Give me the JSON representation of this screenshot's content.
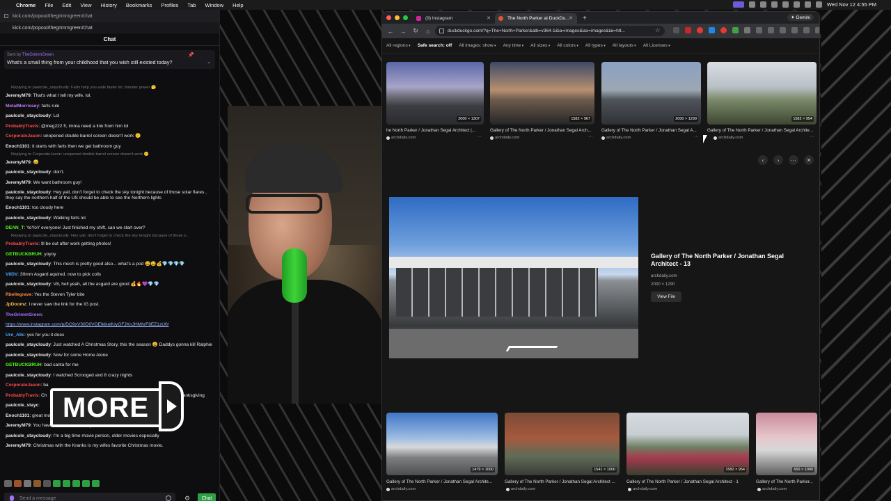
{
  "menubar": {
    "app": "Chrome",
    "items": [
      "File",
      "Edit",
      "View",
      "History",
      "Bookmarks",
      "Profiles",
      "Tab",
      "Window",
      "Help"
    ],
    "clock": "Wed Nov 12  4:55 PM"
  },
  "chat_window": {
    "url": "kick.com/popout/thegrimmgreen/chat",
    "url2": "kick.com/popout/thegrimmgreen/chat",
    "header": "Chat",
    "pinned": {
      "sent_by_prefix": "Sent by",
      "sent_by_user": "TheGrimmGreen",
      "question": "What's a small thing from your childhood that you wish still existed today?"
    },
    "messages": [
      {
        "type": "reply",
        "text": "Replying to paulcole_staycloudy: Farts help you walk faster lol, booster power 🤔"
      },
      {
        "user": "JeremyM79",
        "color": "#e8e8e8",
        "text": "That's what I tell my wife. lol."
      },
      {
        "user": "MetalMorrissey",
        "color": "#c27cff",
        "text": "farts rule"
      },
      {
        "user": "paulcole_staycloudy",
        "color": "#e8e8e8",
        "text": "Lol"
      },
      {
        "user": "ProbablyTravis",
        "color": "#ff4b4b",
        "text": "@meg222 fr, imma need a link from him lol"
      },
      {
        "user": "CorporateJason",
        "color": "#ff4b4b",
        "text": "unopened double barrel screen doesn't work 😕"
      },
      {
        "user": "Enoch1101",
        "color": "#e8e8e8",
        "text": "it starts with farts then we get bathroom guy"
      },
      {
        "type": "reply",
        "text": "Replying to CorporateJason: unopened double barrel screen doesn't work 😕"
      },
      {
        "user": "JeremyM79",
        "color": "#e8e8e8",
        "text": "😄"
      },
      {
        "user": "paulcole_staycloudy",
        "color": "#e8e8e8",
        "text": "don't."
      },
      {
        "user": "JeremyM79",
        "color": "#e8e8e8",
        "text": "We want bathroom guy!"
      },
      {
        "user": "paulcole_staycloudy",
        "color": "#e8e8e8",
        "text": "Hey yall, don't forget to check the sky tonight because of those solar flares , they say the northern half of the US should be able to see the Northern lights",
        "wrap": true
      },
      {
        "user": "Enoch1101",
        "color": "#e8e8e8",
        "text": "too cloudy here"
      },
      {
        "user": "paulcole_staycloudy",
        "color": "#e8e8e8",
        "text": "Walking farts lol"
      },
      {
        "user": "DEAN_T",
        "color": "#53fc18",
        "text": "YoYoY everyone! Just finished my shift, can we start over?"
      },
      {
        "type": "reply",
        "text": "Replying to paulcole_staycloudy: Hey yall, don't forget to check the sky tonight because of those s..."
      },
      {
        "user": "ProbablyTravis",
        "color": "#ff4b4b",
        "text": "Ill be out after work getting photos!"
      },
      {
        "user": "GETBUCKBRUH",
        "color": "#53fc18",
        "text": "yoyoy"
      },
      {
        "user": "paulcole_staycloudy",
        "color": "#e8e8e8",
        "text": "This mech is pretty good also... what's a pod 😄😄💰💎💎💎💎"
      },
      {
        "user": "V8DV",
        "color": "#4aa8ff",
        "text": "30mm Asgard aquired. now to pick coils"
      },
      {
        "user": "paulcole_staycloudy",
        "color": "#e8e8e8",
        "text": "V8, hell yeah, all the asgard are good 💰🔥💜💎💎"
      },
      {
        "user": "Rbellegrave",
        "color": "#ff8a3d",
        "text": "Yes the Steven Tyler bite"
      },
      {
        "user": "JpDoomz",
        "color": "#ffb84a",
        "text": "I never saw the link for the IG post."
      },
      {
        "user": "TheGrimmGreen",
        "color": "#a970ff",
        "text": ""
      },
      {
        "type": "link",
        "text": "https://www.instagram.com/p/DQ9xV30D0VOElklkellUyGFJKnJHMhrF8EZ1zU0/"
      },
      {
        "user": "Urn_A6c",
        "color": "#4aa8ff",
        "text": "yes for you it does"
      },
      {
        "user": "paulcole_staycloudy",
        "color": "#e8e8e8",
        "text": "Just watched A Christmas Story, this the season 😀 Daddys gonna kill Ralphie",
        "wrap": true
      },
      {
        "user": "paulcole_staycloudy",
        "color": "#e8e8e8",
        "text": "Now for some Home Alone"
      },
      {
        "user": "GETBUCKBRUH",
        "color": "#53fc18",
        "text": "bad santa for me"
      },
      {
        "user": "paulcole_staycloudy",
        "color": "#e8e8e8",
        "text": "I watched Scrooged and 8 crazy nights"
      },
      {
        "user": "CorporateJason",
        "color": "#ff4b4b",
        "text": "ba"
      },
      {
        "user": "ProbablyTravis",
        "color": "#ff4b4b",
        "text": "Ch",
        "tail": "a week after Thanksgiving"
      },
      {
        "user": "paulcole_stayc",
        "color": "#e8e8e8",
        "text": "",
        "tail": "ately"
      },
      {
        "user": "Enoch1101",
        "color": "#e8e8e8",
        "text": "great movie Jason"
      },
      {
        "user": "JeremyM79",
        "color": "#e8e8e8",
        "text": "You have a mod I want that you don't use. Its the Protocol 18350 mod."
      },
      {
        "user": "paulcole_staycloudy",
        "color": "#e8e8e8",
        "text": "I'm a big time movie person, older movies especially"
      },
      {
        "user": "JeremyM79",
        "color": "#e8e8e8",
        "text": "Christmas with the Kranks is my wifes favorite Christmas movie."
      }
    ],
    "input_placeholder": "Send a message",
    "send_label": "Chat"
  },
  "overlay": {
    "more_label": "MORE"
  },
  "browser": {
    "tabs": [
      {
        "title": "(9) Instagram",
        "active": false
      },
      {
        "title": "The North Parker at DuckDu...",
        "active": true
      }
    ],
    "gemini_label": "Gemini",
    "url": "duckduckgo.com/?q=The+North+Parker&atb=v364-1&ia=images&iax=images&iai=htt...",
    "filters": [
      {
        "label": "All regions",
        "bold": false
      },
      {
        "label": "Safe search: off",
        "bold": true
      },
      {
        "label": "All images: show",
        "bold": false
      },
      {
        "label": "Any time",
        "bold": false
      },
      {
        "label": "All sizes",
        "bold": false
      },
      {
        "label": "All colors",
        "bold": false
      },
      {
        "label": "All types",
        "bold": false
      },
      {
        "label": "All layouts",
        "bold": false
      },
      {
        "label": "All Licenses",
        "bold": false
      }
    ],
    "top_results": [
      {
        "caption": "he North Parker / Jonathan Segal Architect |...",
        "source": "archdaily.com",
        "dims": "2000 × 1307"
      },
      {
        "caption": "Gallery of The North Parker / Jonathan Segal Arch...",
        "source": "archdaily.com",
        "dims": "1582 × 967"
      },
      {
        "caption": "Gallery of The North Parker / Jonathan Segal A...",
        "source": "archdaily.com",
        "dims": "2000 × 1290"
      },
      {
        "caption": "Gallery of The North Parker / Jonathan Segal Archite...",
        "source": "archdaily.com",
        "dims": "1582 × 954"
      }
    ],
    "detail": {
      "title": "Gallery of The North Parker / Jonathan Segal Architect - 13",
      "source": "archdaily.com",
      "dims": "2000 × 1290",
      "view_label": "View File"
    },
    "bottom_results": [
      {
        "caption": "Gallery of The North Parker / Jonathan Segal Archite...",
        "source": "archdaily.com",
        "dims": "1479 × 1000"
      },
      {
        "caption": "Gallery of The North Parker / Jonathan Segal Architect ...",
        "source": "archdaily.com",
        "dims": "1541 × 1000"
      },
      {
        "caption": "Gallery of The North Parker / Jonathan Segal Architect - 1",
        "source": "archdaily.com",
        "dims": "1582 × 954"
      },
      {
        "caption": "Gallery of The North Parker...",
        "source": "archdaily.com",
        "dims": "650 × 1000"
      }
    ]
  }
}
